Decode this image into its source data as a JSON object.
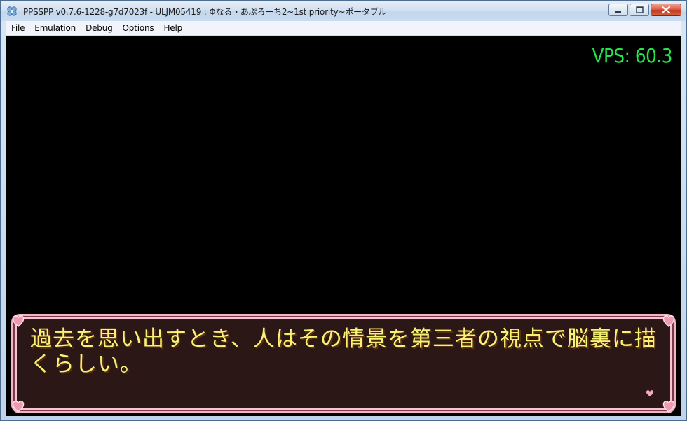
{
  "window": {
    "title": "PPSSPP v0.7.6-1228-g7d7023f - ULJM05419 : Φなる・あぷろーち2~1st priority~ポータブル",
    "icon": "ppsspp-app-icon"
  },
  "menu": {
    "items": [
      {
        "accel": "F",
        "rest": "ile"
      },
      {
        "accel": "E",
        "rest": "mulation"
      },
      {
        "accel": "",
        "rest": "Debug"
      },
      {
        "accel": "O",
        "rest": "ptions"
      },
      {
        "accel": "H",
        "rest": "elp"
      }
    ]
  },
  "screen": {
    "vps_readout": "VPS: 60.3",
    "dialog_text": "過去を思い出すとき、人はその情景を第三者の視点で脳裏に描くらしい。"
  },
  "colors": {
    "vps": "#22e64a",
    "dialog_text": "#f6f273",
    "dialog_border": "#f4b3c3",
    "dialog_bg": "#2b1817"
  }
}
